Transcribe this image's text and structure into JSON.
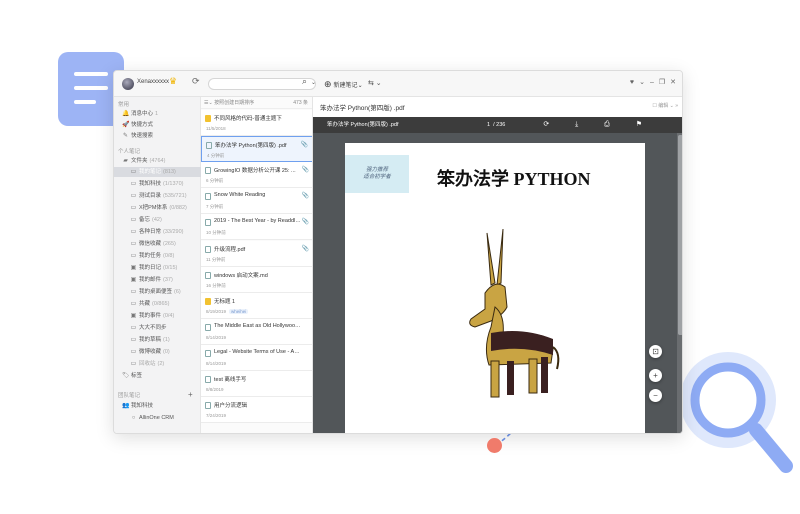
{
  "topbar": {
    "username": "Xenaxxxxxx",
    "new_note_label": "新建笔记",
    "crown": "♛",
    "sync": "⟳",
    "search_icon": "⌕",
    "dropdown": "⌄",
    "sync_btn": "⇆ ⌄",
    "window_controls": [
      "♥",
      "⌄",
      "–",
      "❐",
      "✕"
    ]
  },
  "sidebar": {
    "section_common": "常用",
    "section_personal": "个人笔记",
    "section_team": "团队笔记",
    "items": [
      {
        "label": "消息中心",
        "count": "1",
        "icon": "🔔"
      },
      {
        "label": "快捷方式",
        "count": "",
        "icon": "🚀"
      },
      {
        "label": "快速搜索",
        "count": "",
        "icon": "✎"
      },
      {
        "label": "文件夹",
        "count": "(4764)",
        "icon": "▰"
      },
      {
        "label": "我的笔记",
        "count": "(813)",
        "icon": "▭"
      },
      {
        "label": "我知科技",
        "count": "(1/1370)",
        "icon": "▭"
      },
      {
        "label": "测试目录",
        "count": "(535/721)",
        "icon": "▭"
      },
      {
        "label": "X把PM体系",
        "count": "(0/882)",
        "icon": "▭"
      },
      {
        "label": "备忘",
        "count": "(42)",
        "icon": "▭"
      },
      {
        "label": "各种日常",
        "count": "(33/290)",
        "icon": "▭"
      },
      {
        "label": "微信收藏",
        "count": "(265)",
        "icon": "▭"
      },
      {
        "label": "我的任务",
        "count": "(0/8)",
        "icon": "▭"
      },
      {
        "label": "我的日记",
        "count": "(0/15)",
        "icon": "▣"
      },
      {
        "label": "我的邮件",
        "count": "(37)",
        "icon": "▣"
      },
      {
        "label": "我的桌面便签",
        "count": "(6)",
        "icon": "▭"
      },
      {
        "label": "共藏",
        "count": "(0/865)",
        "icon": "▭"
      },
      {
        "label": "我的事件",
        "count": "(0/4)",
        "icon": "▣"
      },
      {
        "label": "大大不同步",
        "count": "",
        "icon": "▭"
      },
      {
        "label": "我的草稿",
        "count": "(1)",
        "icon": "▭"
      },
      {
        "label": "微博收藏",
        "count": "(0)",
        "icon": "▭"
      },
      {
        "label": "回收站",
        "count": "(2)",
        "icon": "▭"
      },
      {
        "label": "标签",
        "count": "",
        "icon": "🏷"
      },
      {
        "label": "我知科技",
        "count": "",
        "icon": "👥"
      },
      {
        "label": "AllinOne CRM",
        "count": "",
        "icon": "○"
      }
    ],
    "plus": "+"
  },
  "notelist": {
    "sort_label": "按照创建日期排序",
    "count": "473 条",
    "notes": [
      {
        "title": "不同风格的代码-普通主题下",
        "meta": "11/5/2018",
        "tag": "",
        "clip": false,
        "icon": "star"
      },
      {
        "title": "笨办法学 Python(第四版) .pdf",
        "meta": "4 分钟前",
        "tag": "",
        "clip": true,
        "icon": "doc"
      },
      {
        "title": "GrowingIO 数据分析公开课 25: ...",
        "meta": "6 分钟前",
        "tag": "",
        "clip": true,
        "icon": "doc"
      },
      {
        "title": "Snow White Reading",
        "meta": "7 分钟前",
        "tag": "",
        "clip": true,
        "icon": "doc"
      },
      {
        "title": "2019 - The Best Year - by Readdle...",
        "meta": "10 分钟前",
        "tag": "",
        "clip": true,
        "icon": "doc"
      },
      {
        "title": "升级流程.pdf",
        "meta": "11 分钟前",
        "tag": "",
        "clip": true,
        "icon": "doc"
      },
      {
        "title": "windows 启动文案.md",
        "meta": "16 分钟前",
        "tag": "",
        "clip": false,
        "icon": "doc"
      },
      {
        "title": "无标题 1",
        "meta": "8/19/2019",
        "tag": "wheihei",
        "clip": false,
        "icon": "star"
      },
      {
        "title": "The Middle East as Old Hollywood Sa...",
        "meta": "8/14/2019",
        "tag": "",
        "clip": false,
        "icon": "doc"
      },
      {
        "title": "Legal - Website Terms of Use - Apple",
        "meta": "8/14/2019",
        "tag": "",
        "clip": false,
        "icon": "doc"
      },
      {
        "title": "test 离线手写",
        "meta": "8/8/2019",
        "tag": "",
        "clip": false,
        "icon": "doc"
      },
      {
        "title": "用户分流逻辑",
        "meta": "7/24/2019",
        "tag": "",
        "clip": false,
        "icon": "doc"
      }
    ]
  },
  "viewer": {
    "title": "笨办法学 Python(第四版) .pdf",
    "tools": "☐ 编辑 ⌄   »",
    "pdf_filename": "笨办法学 Python(第四版) .pdf",
    "page_current": "1",
    "page_total": "/ 236",
    "toolbar_icons": "⟳ ⤓ ⎙ ⚑",
    "badge_line1": "强力推荐",
    "badge_line2": "适合初学者",
    "book_title": "笨办法学 PYTHON",
    "fit_icon": "⊡",
    "zoom_in": "+",
    "zoom_out": "−"
  },
  "colors": {
    "accent": "#6fa0ef",
    "pdf_bar": "#3c3c3c",
    "pdf_bg": "#525659",
    "deco_blue": "#9db4f5",
    "deco_red": "#f07b6b"
  }
}
